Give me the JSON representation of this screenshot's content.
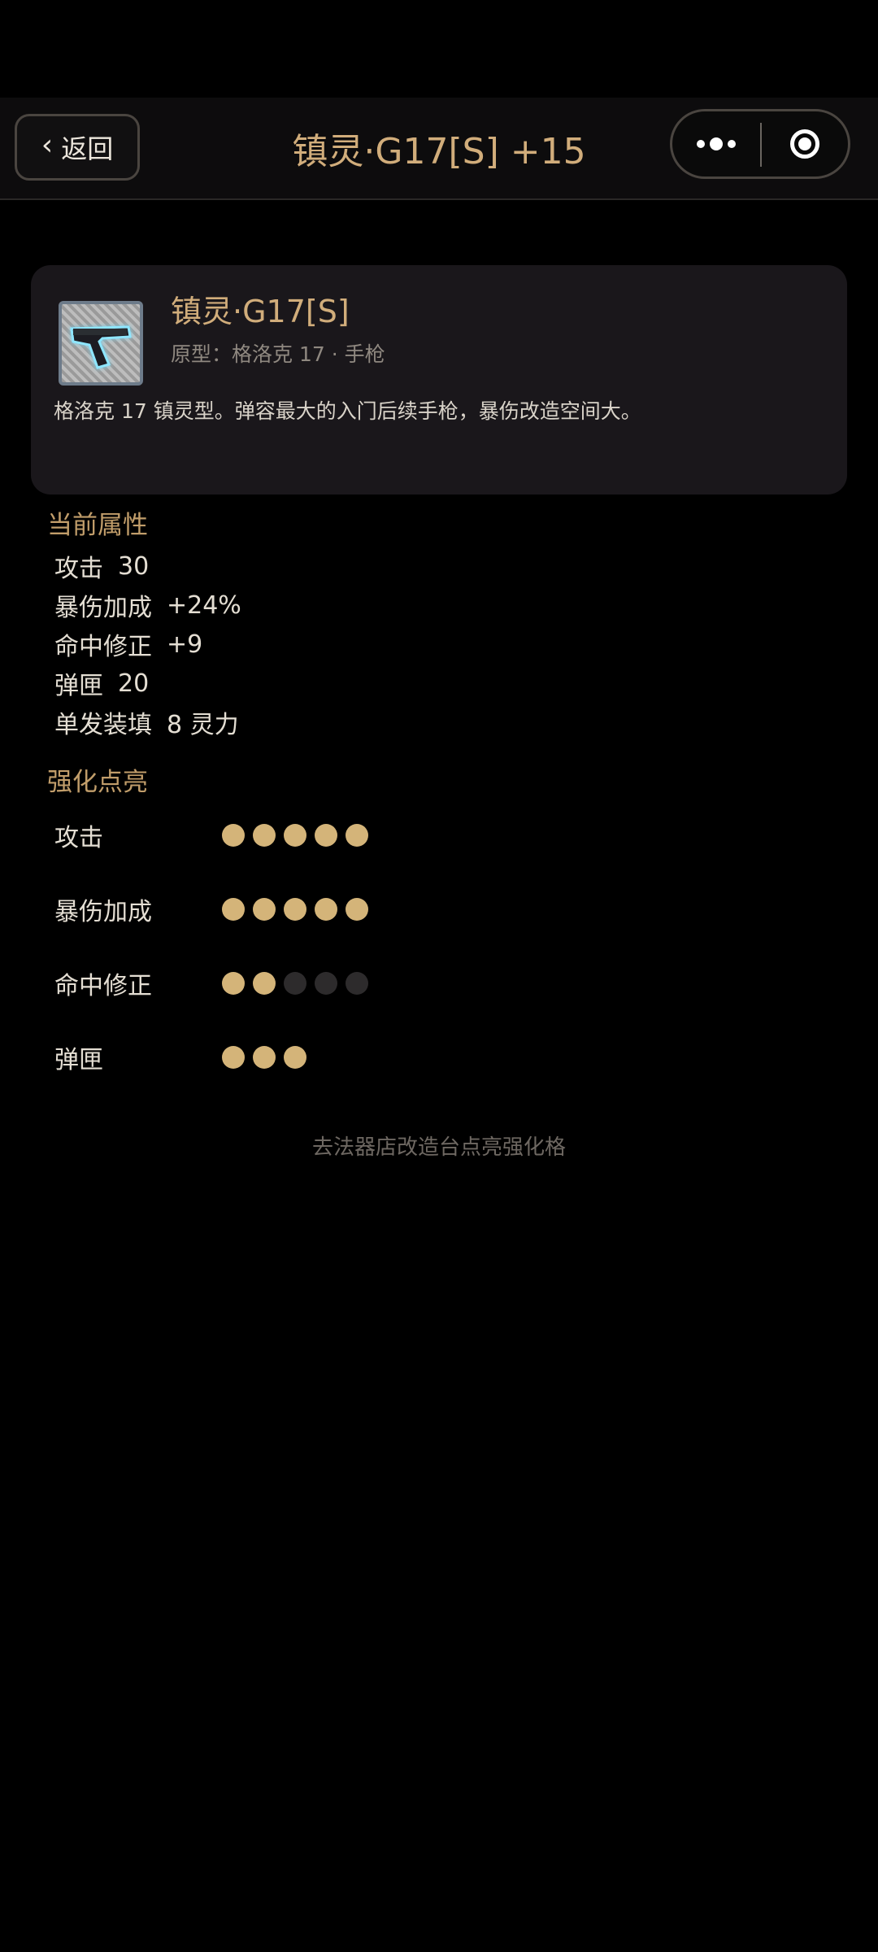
{
  "nav": {
    "back_label": "返回",
    "title": "镇灵·G17[S] +15"
  },
  "item": {
    "name": "镇灵·G17[S]",
    "subtitle": "原型：格洛克 17 · 手枪",
    "description": "格洛克 17 镇灵型。弹容最大的入门后续手枪，暴伤改造空间大。",
    "thumbnail_icon": "pistol-icon"
  },
  "current_attributes": {
    "title": "当前属性",
    "rows": [
      {
        "label": "攻击",
        "value": "30"
      },
      {
        "label": "暴伤加成",
        "value": "+24%"
      },
      {
        "label": "命中修正",
        "value": "+9"
      },
      {
        "label": "弹匣",
        "value": "20"
      },
      {
        "label": "单发装填",
        "value": "8 灵力"
      }
    ]
  },
  "enhancement": {
    "title": "强化点亮",
    "rows": [
      {
        "label": "攻击",
        "lit": 5,
        "total": 5
      },
      {
        "label": "暴伤加成",
        "lit": 5,
        "total": 5
      },
      {
        "label": "命中修正",
        "lit": 2,
        "total": 5
      },
      {
        "label": "弹匣",
        "lit": 3,
        "total": 3
      }
    ],
    "hint": "去法器店改造台点亮强化格"
  },
  "colors": {
    "accent": "#d1ad7b",
    "dot_on": "#d4b479",
    "dot_off": "#2d2b2c",
    "card_bg": "#1a171b"
  }
}
